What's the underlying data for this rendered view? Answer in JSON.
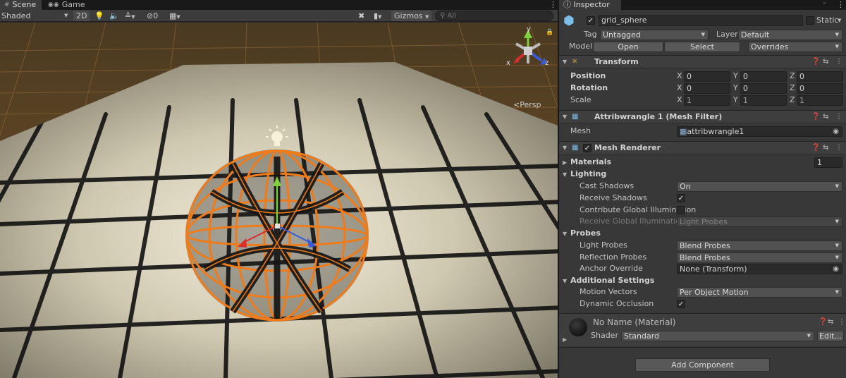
{
  "tabs": {
    "scene": "Scene",
    "game": "Game"
  },
  "scene_toolbar": {
    "draw_mode": "Shaded",
    "mode_2d": "2D",
    "hidden_count": "0",
    "gizmos": "Gizmos",
    "search_placeholder": "All"
  },
  "viewport": {
    "axis_y": "y",
    "axis_x": "x",
    "axis_z": "z",
    "projection": "Persp"
  },
  "inspector": {
    "tab": "Inspector",
    "object_name": "grid_sphere",
    "static_label": "Static",
    "tag_label": "Tag",
    "tag_value": "Untagged",
    "layer_label": "Layer",
    "layer_value": "Default",
    "model_label": "Model",
    "open_btn": "Open",
    "select_btn": "Select",
    "overrides": "Overrides",
    "transform": {
      "title": "Transform",
      "position_label": "Position",
      "rotation_label": "Rotation",
      "scale_label": "Scale",
      "axis_x": "X",
      "axis_y": "Y",
      "axis_z": "Z",
      "position": [
        "0",
        "0",
        "0"
      ],
      "rotation": [
        "0",
        "0",
        "0"
      ],
      "scale": [
        "1",
        "1",
        "1"
      ]
    },
    "mesh_filter": {
      "title": "Attribwrangle 1 (Mesh Filter)",
      "mesh_label": "Mesh",
      "mesh_value": "attribwrangle1"
    },
    "mesh_renderer": {
      "title": "Mesh Renderer",
      "materials_label": "Materials",
      "materials_count": "1",
      "lighting_label": "Lighting",
      "cast_shadows_label": "Cast Shadows",
      "cast_shadows_value": "On",
      "receive_shadows_label": "Receive Shadows",
      "contribute_gi_label": "Contribute Global Illumination",
      "receive_gi_label": "Receive Global Illumination",
      "receive_gi_value": "Light Probes",
      "probes_label": "Probes",
      "light_probes_label": "Light Probes",
      "light_probes_value": "Blend Probes",
      "reflection_probes_label": "Reflection Probes",
      "reflection_probes_value": "Blend Probes",
      "anchor_override_label": "Anchor Override",
      "anchor_override_value": "None (Transform)",
      "additional_label": "Additional Settings",
      "motion_vectors_label": "Motion Vectors",
      "motion_vectors_value": "Per Object Motion",
      "dynamic_occlusion_label": "Dynamic Occlusion"
    },
    "material": {
      "name": "No Name (Material)",
      "shader_label": "Shader",
      "shader_value": "Standard",
      "edit_btn": "Edit..."
    },
    "add_component": "Add Component"
  },
  "colors": {
    "accent_orange": "#f07b1a",
    "panel_bg": "#383838",
    "toolbar_bg": "#3c3c3c",
    "gizmo_y": "#7fd13b",
    "gizmo_x": "#d62d2d",
    "gizmo_z": "#3a5bd6"
  }
}
